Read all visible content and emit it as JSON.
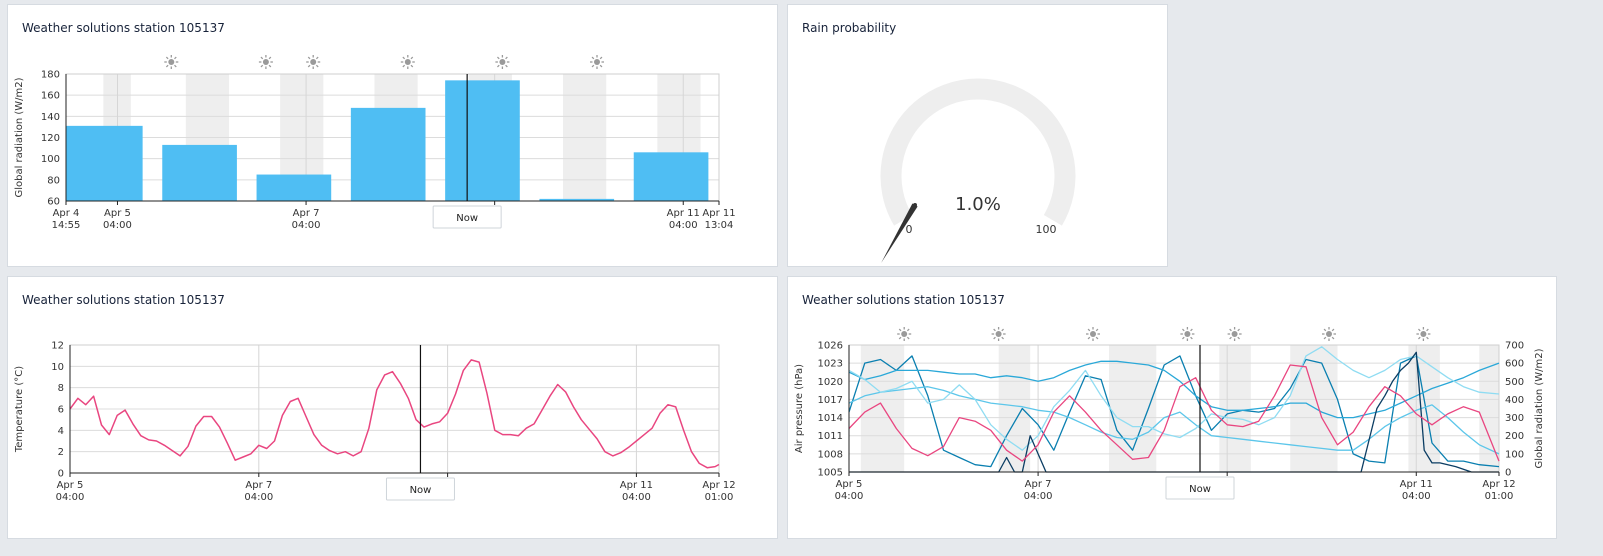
{
  "colors": {
    "bar": "#4fbef3",
    "temperature": "#e94680",
    "night_band": "#eeeeee",
    "gauge_track": "#eeeeee",
    "needle": "#333333",
    "multi_lines": [
      "#0a7fb0",
      "#2aa8d8",
      "#5cc6ea",
      "#8fdcf2",
      "#0b3d63",
      "#e94680"
    ]
  },
  "panels": {
    "radiation": {
      "title": "Weather solutions station 105137",
      "now_label": "Now",
      "icons": [
        "moon-icon",
        "sun-icon",
        "moon-icon",
        "sun-icon",
        "sun-icon",
        "moon-icon",
        "sun-icon",
        "moon-icon",
        "sun-icon",
        "moon-icon",
        "sun-icon",
        "moon-icon"
      ]
    },
    "rain": {
      "title": "Rain probability",
      "value": 1.0,
      "value_label": "1.0%",
      "min_label": "0",
      "max_label": "100"
    },
    "temperature": {
      "title": "Weather solutions station 105137",
      "now_label": "Now"
    },
    "multi": {
      "title": "Weather solutions station 105137",
      "now_label": "Now",
      "icons": [
        "moon-icon",
        "sun-icon",
        "moon-icon",
        "sun-icon",
        "moon-icon",
        "sun-icon",
        "moon-icon",
        "sun-icon",
        "sun-icon",
        "moon-icon",
        "sun-icon",
        "moon-icon",
        "sun-icon",
        "moon-icon"
      ]
    }
  },
  "chart_data": [
    {
      "type": "bar",
      "ylabel": "Global radiation  (W/m2)",
      "ylim": [
        60,
        180
      ],
      "yticks": [
        "60",
        "80",
        "100",
        "120",
        "140",
        "160",
        "180"
      ],
      "x_ticks": [
        {
          "x": 0.0,
          "l1": "Apr 4",
          "l2": "14:55"
        },
        {
          "x": 13.1,
          "l1": "Apr 5",
          "l2": "04:00"
        },
        {
          "x": 61.1,
          "l1": "Apr 7",
          "l2": "04:00"
        },
        {
          "x": 109.1,
          "l1": "",
          "l2": ""
        },
        {
          "x": 157.1,
          "l1": "Apr 11",
          "l2": "04:00"
        },
        {
          "x": 166.2,
          "l1": "Apr 11",
          "l2": "13:04"
        }
      ],
      "x_range": [
        0,
        166.2
      ],
      "now_x": 102.1,
      "bars": [
        {
          "start": 0.0,
          "end": 19.5,
          "value": 131
        },
        {
          "start": 24.5,
          "end": 43.5,
          "value": 113
        },
        {
          "start": 48.5,
          "end": 67.5,
          "value": 85
        },
        {
          "start": 72.5,
          "end": 91.5,
          "value": 148
        },
        {
          "start": 96.5,
          "end": 115.5,
          "value": 174
        },
        {
          "start": 120.5,
          "end": 139.5,
          "value": 62
        },
        {
          "start": 144.5,
          "end": 163.5,
          "value": 106
        }
      ],
      "nights": [
        [
          9.5,
          16.5
        ],
        [
          30.5,
          41.5
        ],
        [
          54.5,
          65.5
        ],
        [
          78.5,
          89.5
        ],
        [
          102.5,
          113.5
        ],
        [
          126.5,
          137.5
        ],
        [
          150.5,
          161.5
        ]
      ]
    },
    {
      "type": "line",
      "ylabel": "Temperature (°C)",
      "ylim": [
        0,
        12
      ],
      "yticks": [
        "0",
        "2",
        "4",
        "6",
        "8",
        "10",
        "12"
      ],
      "x_ticks": [
        {
          "x": 0,
          "l1": "Apr 5",
          "l2": "04:00"
        },
        {
          "x": 48,
          "l1": "Apr 7",
          "l2": "04:00"
        },
        {
          "x": 96,
          "l1": "",
          "l2": ""
        },
        {
          "x": 144,
          "l1": "Apr 11",
          "l2": "04:00"
        },
        {
          "x": 165,
          "l1": "Apr 12",
          "l2": "01:00"
        }
      ],
      "x_range": [
        0,
        165
      ],
      "now_x": 89.1,
      "series": [
        {
          "x": [
            0,
            2,
            4,
            6,
            8,
            10,
            12,
            14,
            16,
            18,
            20,
            22,
            24,
            26,
            28,
            30,
            32,
            34,
            36,
            38,
            40,
            42,
            44,
            46,
            48,
            50,
            52,
            54,
            56,
            58,
            60,
            62,
            64,
            66,
            68,
            70,
            72,
            74,
            76,
            78,
            80,
            82,
            84,
            86,
            88,
            90,
            92,
            94,
            96,
            98,
            100,
            102,
            104,
            106,
            108,
            110,
            112,
            114,
            116,
            118,
            120,
            122,
            124,
            126,
            128,
            130,
            132,
            134,
            136,
            138,
            140,
            142,
            144,
            146,
            148,
            150,
            152,
            154,
            156,
            158,
            160,
            162,
            164,
            165
          ],
          "y": [
            6.0,
            7.0,
            6.4,
            7.2,
            4.5,
            3.6,
            5.4,
            5.9,
            4.6,
            3.5,
            3.1,
            3.0,
            2.6,
            2.1,
            1.6,
            2.5,
            4.4,
            5.3,
            5.3,
            4.3,
            2.8,
            1.2,
            1.5,
            1.8,
            2.6,
            2.3,
            3.0,
            5.4,
            6.7,
            7.0,
            5.3,
            3.6,
            2.6,
            2.1,
            1.8,
            2.0,
            1.6,
            2.0,
            4.2,
            7.8,
            9.2,
            9.5,
            8.4,
            7.0,
            5.0,
            4.3,
            4.6,
            4.8,
            5.6,
            7.4,
            9.6,
            10.6,
            10.4,
            7.5,
            4.0,
            3.6,
            3.6,
            3.5,
            4.2,
            4.6,
            5.9,
            7.2,
            8.3,
            7.6,
            6.2,
            5.0,
            4.1,
            3.2,
            2.0,
            1.6,
            1.9,
            2.4,
            3.0,
            3.6,
            4.2,
            5.6,
            6.4,
            6.2,
            4.0,
            2.0,
            0.9,
            0.5,
            0.6,
            0.8
          ]
        }
      ]
    },
    {
      "type": "line",
      "ylabel": "Air pressure (hPa)",
      "y2label": "Global radiation  (W/m2)",
      "ylim": [
        1005,
        1026
      ],
      "yticks": [
        "1005",
        "1008",
        "1011",
        "1014",
        "1017",
        "1020",
        "1023",
        "1026"
      ],
      "y2lim": [
        0,
        700
      ],
      "y2ticks": [
        "0",
        "100",
        "200",
        "300",
        "400",
        "500",
        "600",
        "700"
      ],
      "x_ticks": [
        {
          "x": 0,
          "l1": "Apr 5",
          "l2": "04:00"
        },
        {
          "x": 48,
          "l1": "Apr 7",
          "l2": "04:00"
        },
        {
          "x": 96,
          "l1": "",
          "l2": ""
        },
        {
          "x": 144,
          "l1": "Apr 11",
          "l2": "04:00"
        },
        {
          "x": 165,
          "l1": "Apr 12",
          "l2": "01:00"
        }
      ],
      "x_range": [
        0,
        165
      ],
      "now_x": 89.1,
      "series": [
        {
          "axis": "y2",
          "x": [
            0,
            4,
            8,
            12,
            16,
            20,
            24,
            28,
            32,
            36,
            40,
            44,
            48,
            52,
            56,
            60,
            64,
            68,
            72,
            76,
            80,
            84,
            88,
            92,
            96,
            100,
            104,
            108,
            112,
            116,
            120,
            124,
            128,
            132,
            136,
            140,
            144,
            148,
            152,
            156,
            160,
            165
          ],
          "y": [
            330,
            600,
            620,
            560,
            640,
            420,
            120,
            80,
            40,
            30,
            200,
            350,
            260,
            120,
            330,
            530,
            510,
            230,
            120,
            350,
            590,
            640,
            420,
            230,
            320,
            340,
            330,
            350,
            460,
            620,
            600,
            400,
            100,
            60,
            50,
            600,
            640,
            160,
            60,
            60,
            40,
            30
          ]
        },
        {
          "axis": "y2",
          "x": [
            0,
            4,
            8,
            12,
            16,
            20,
            24,
            28,
            32,
            36,
            40,
            44,
            48,
            52,
            56,
            60,
            64,
            68,
            72,
            76,
            80,
            84,
            88,
            92,
            96,
            100,
            104,
            108,
            112,
            116,
            120,
            124,
            128,
            132,
            136,
            140,
            144,
            148,
            152,
            156,
            160,
            165
          ],
          "y": [
            550,
            510,
            530,
            560,
            560,
            560,
            550,
            540,
            540,
            520,
            530,
            520,
            500,
            520,
            560,
            590,
            610,
            610,
            600,
            590,
            560,
            500,
            420,
            360,
            340,
            340,
            350,
            360,
            380,
            380,
            330,
            300,
            300,
            320,
            340,
            380,
            420,
            460,
            490,
            520,
            560,
            600
          ]
        },
        {
          "axis": "y2",
          "x": [
            0,
            4,
            8,
            12,
            16,
            20,
            24,
            28,
            32,
            36,
            40,
            44,
            48,
            52,
            56,
            60,
            64,
            68,
            72,
            76,
            80,
            84,
            88,
            92,
            96,
            100,
            104,
            108,
            112,
            116,
            120,
            124,
            128,
            132,
            136,
            140,
            144,
            148,
            152,
            156,
            160,
            165
          ],
          "y": [
            380,
            420,
            440,
            450,
            460,
            470,
            450,
            420,
            400,
            380,
            370,
            360,
            340,
            330,
            300,
            260,
            220,
            190,
            180,
            220,
            300,
            330,
            260,
            200,
            190,
            180,
            170,
            160,
            150,
            140,
            130,
            120,
            120,
            180,
            250,
            300,
            340,
            370,
            300,
            220,
            150,
            100
          ]
        },
        {
          "axis": "y2",
          "x": [
            0,
            4,
            8,
            12,
            16,
            20,
            24,
            28,
            32,
            36,
            40,
            44,
            48,
            52,
            56,
            60,
            64,
            68,
            72,
            76,
            80,
            84,
            88,
            92,
            96,
            100,
            104,
            108,
            112,
            116,
            120,
            124,
            128,
            132,
            136,
            140,
            144,
            148,
            152,
            156,
            160,
            165
          ],
          "y": [
            560,
            510,
            440,
            460,
            500,
            380,
            400,
            480,
            400,
            260,
            180,
            120,
            200,
            360,
            450,
            560,
            420,
            300,
            250,
            250,
            210,
            190,
            240,
            320,
            300,
            290,
            260,
            300,
            420,
            640,
            690,
            620,
            560,
            520,
            560,
            620,
            640,
            580,
            520,
            470,
            440,
            430
          ]
        },
        {
          "axis": "y2",
          "x": [
            0,
            10,
            20,
            30,
            38,
            40,
            42,
            44,
            46,
            50,
            60,
            70,
            80,
            90,
            100,
            110,
            120,
            130,
            134,
            136,
            138,
            140,
            142,
            144,
            146,
            148,
            150,
            154,
            158,
            165
          ],
          "y": [
            0,
            0,
            0,
            0,
            0,
            80,
            0,
            0,
            200,
            0,
            0,
            0,
            0,
            0,
            0,
            0,
            0,
            0,
            350,
            420,
            500,
            560,
            600,
            660,
            120,
            50,
            50,
            30,
            0,
            0
          ]
        },
        {
          "axis": "y2",
          "x": [
            0,
            4,
            8,
            12,
            16,
            20,
            24,
            28,
            32,
            36,
            40,
            44,
            48,
            52,
            56,
            60,
            64,
            68,
            72,
            76,
            80,
            84,
            88,
            92,
            96,
            100,
            104,
            108,
            112,
            116,
            120,
            124,
            128,
            132,
            136,
            140,
            144,
            148,
            152,
            156,
            160,
            165
          ],
          "y": [
            240,
            330,
            380,
            240,
            130,
            90,
            140,
            300,
            280,
            230,
            120,
            60,
            150,
            330,
            420,
            330,
            230,
            150,
            70,
            80,
            230,
            470,
            520,
            340,
            260,
            250,
            280,
            420,
            590,
            580,
            300,
            150,
            220,
            360,
            470,
            420,
            320,
            260,
            320,
            360,
            330,
            60
          ]
        }
      ]
    }
  ]
}
